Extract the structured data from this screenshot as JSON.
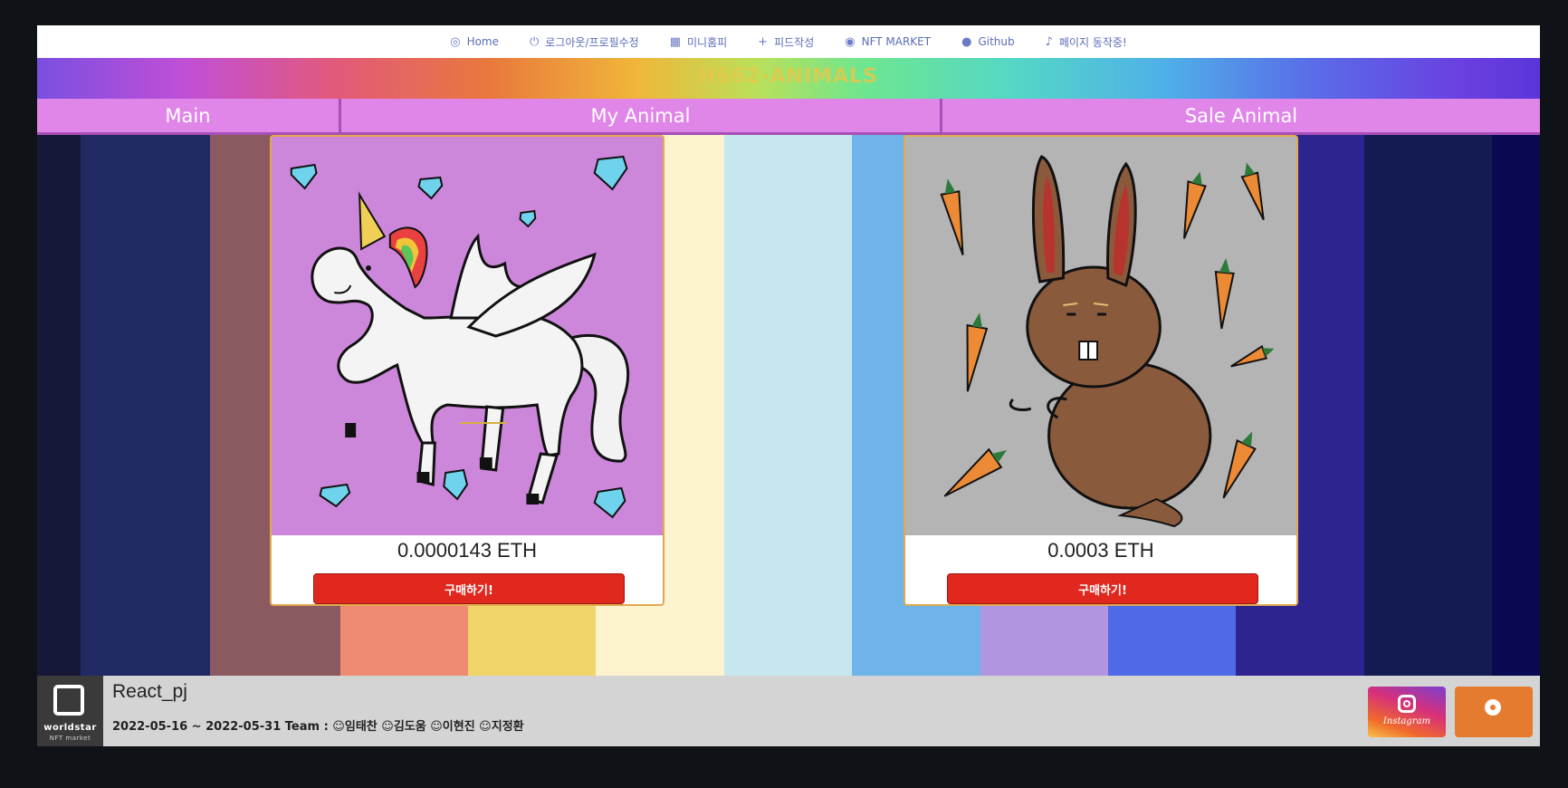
{
  "nav": {
    "items": [
      {
        "icon": "home-icon",
        "glyph": "◎",
        "label": "Home"
      },
      {
        "icon": "logout-icon",
        "glyph": "⏻",
        "label": "로그아웃/프로필수정"
      },
      {
        "icon": "calendar-icon",
        "glyph": "▦",
        "label": "미니홈피"
      },
      {
        "icon": "plus-icon",
        "glyph": "+",
        "label": "피드작성"
      },
      {
        "icon": "coin-icon",
        "glyph": "◉",
        "label": "NFT MARKET"
      },
      {
        "icon": "github-icon",
        "glyph": "●",
        "label": "Github"
      },
      {
        "icon": "music-note-icon",
        "glyph": "♪",
        "label": "페이지 동작중!"
      }
    ]
  },
  "banner": {
    "title": "H662-ANIMALS"
  },
  "tabs": [
    "Main",
    "My Animal",
    "Sale Animal"
  ],
  "stripe_colors": [
    "#161838",
    "#212a63",
    "#8a5a60",
    "#8a5a60",
    "#ee8b72",
    "#f2d56a",
    "#fef3cf",
    "#c7e7ef",
    "#6fb4e8",
    "#b295e0",
    "#4f6ae6",
    "#2e248f",
    "#141a52",
    "#0a0850"
  ],
  "cards": [
    {
      "art": "unicorn",
      "price": "0.0000143 ETH",
      "button": "구매하기!",
      "bg": "#cc86da"
    },
    {
      "art": "rabbit",
      "price": "0.0003 ETH",
      "button": "구매하기!",
      "bg": "#b4b4b4"
    }
  ],
  "footer": {
    "logo_text": "worldstar",
    "logo_sub": "NFT market",
    "project_name": "React_pj",
    "info": "2022-05-16 ~ 2022-05-31 Team : ☺임태찬 ☺김도움 ☺이현진 ☺지정환",
    "instagram_label": "Instagram"
  }
}
